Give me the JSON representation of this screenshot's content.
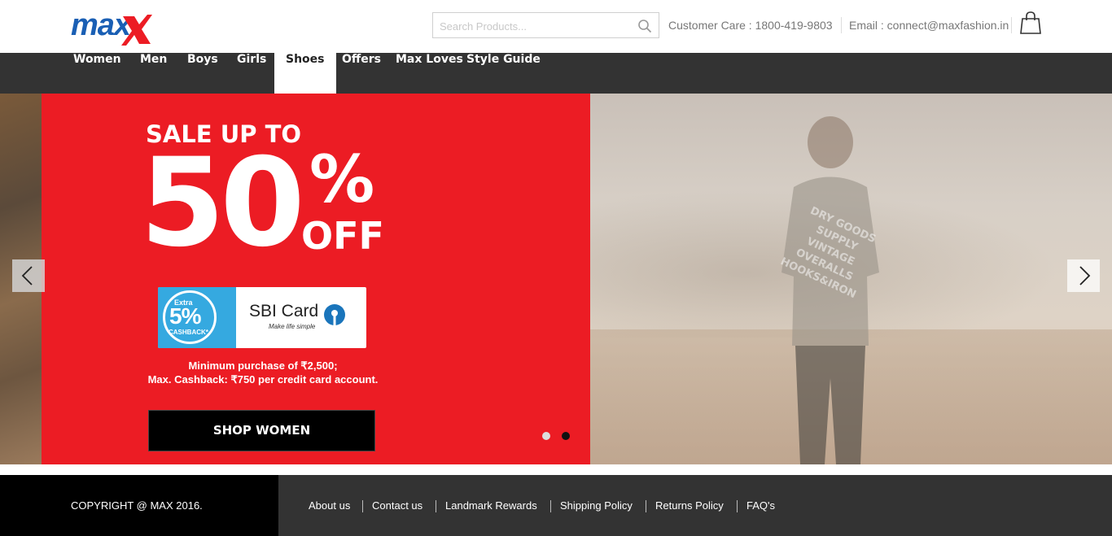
{
  "header": {
    "logo_text": "max",
    "search_placeholder": "Search Products...",
    "customer_care": "Customer Care : 1800-419-9803",
    "email": "Email : connect@maxfashion.in"
  },
  "nav": {
    "items": [
      "Women",
      "Men",
      "Boys",
      "Girls",
      "Shoes",
      "Offers",
      "Max Loves",
      "Style Guide"
    ],
    "active": "Shoes"
  },
  "hero": {
    "sale_line1": "SALE UP TO",
    "sale_number": "50",
    "sale_percent": "%",
    "sale_off": "OFF",
    "card": {
      "extra": "Extra",
      "cashback_pct": "5%",
      "cashback_label": "CASHBACK*",
      "brand": "SBI Card",
      "tagline": "Make life simple"
    },
    "terms_line1": "Minimum purchase of ₹2,500;",
    "terms_line2": "Max. Cashback: ₹750 per credit card account.",
    "shop_button": "SHOP WOMEN",
    "tee_print": "DRY GOODS SUPPLY VINTAGE OVERALLS HOOKS&IRON",
    "slides_total": 2,
    "active_slide": 2
  },
  "footer": {
    "copyright": "COPYRIGHT @ MAX 2016.",
    "links": [
      "About us",
      "Contact us",
      "Landmark Rewards",
      "Shipping Policy",
      "Returns Policy",
      "FAQ's"
    ]
  },
  "colors": {
    "brand_blue": "#1a5fb4",
    "brand_red": "#ec1c24",
    "nav_bg": "#333333",
    "promo_bg": "#ec1c24"
  }
}
